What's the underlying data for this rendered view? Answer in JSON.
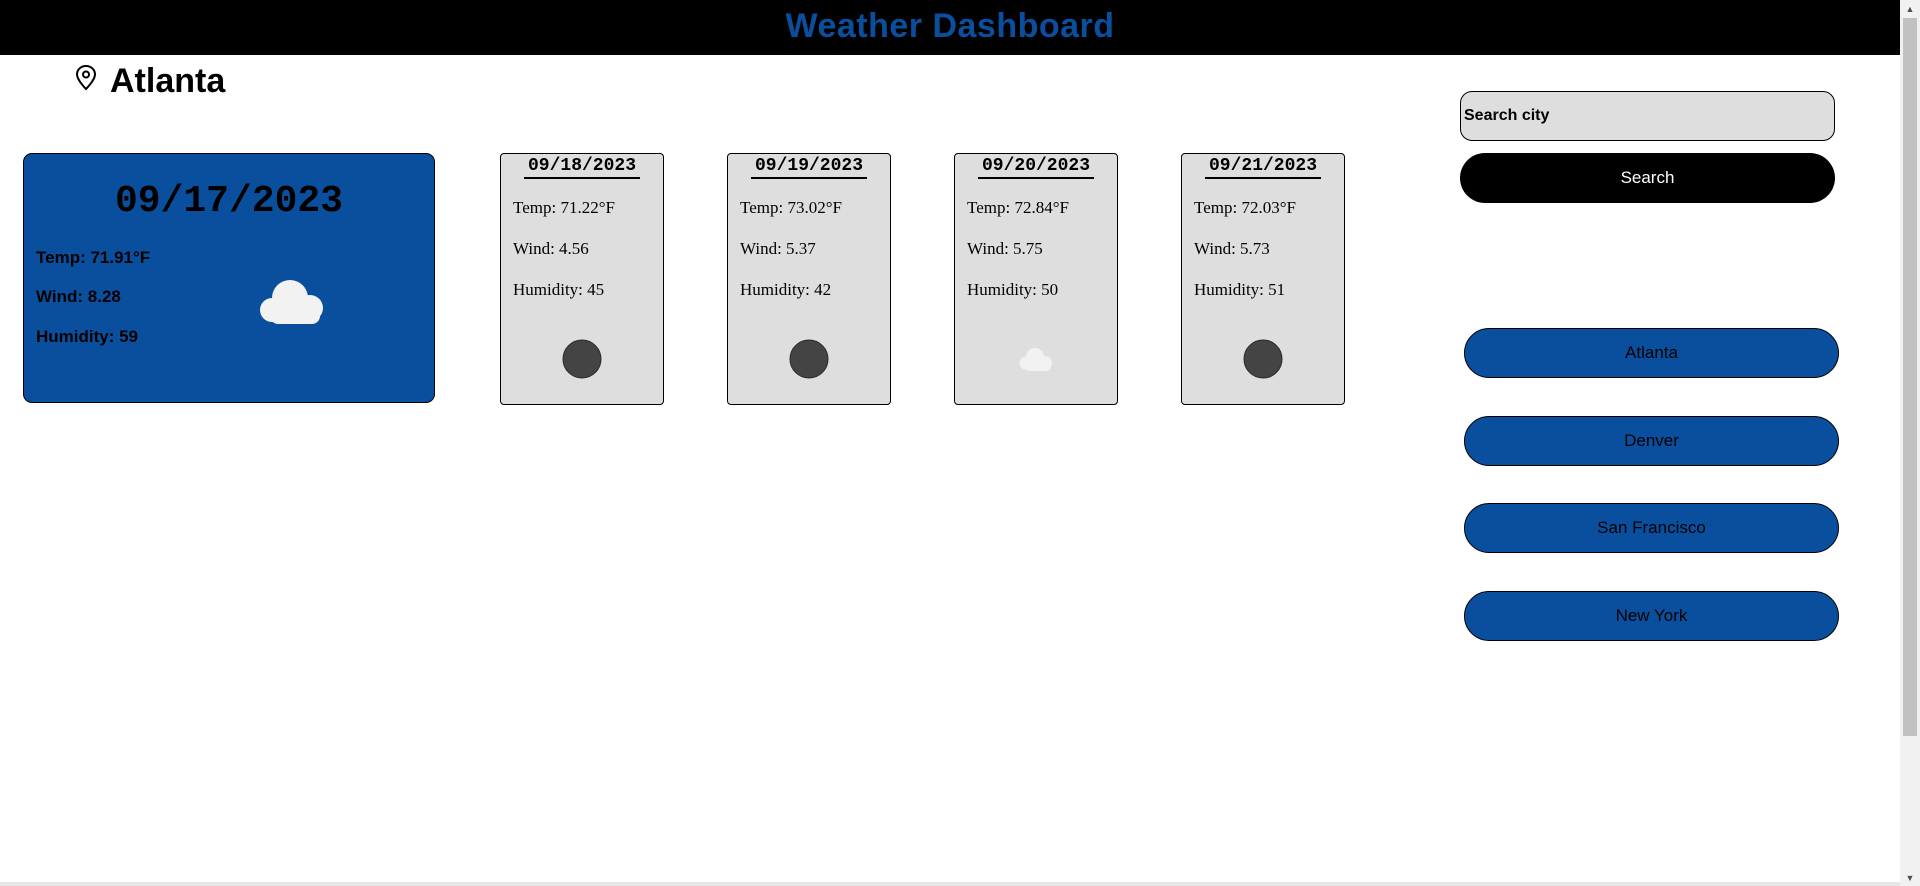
{
  "header": {
    "title": "Weather Dashboard"
  },
  "current": {
    "city": "Atlanta",
    "date": "09/17/2023",
    "temp": "Temp: 71.91°F",
    "wind": "Wind: 8.28",
    "humidity": "Humidity: 59",
    "icon": "cloud-icon"
  },
  "forecast": [
    {
      "date": "09/18/2023",
      "temp": "Temp: 71.22°F",
      "wind": "Wind: 4.56",
      "humidity": "Humidity: 45",
      "icon": "dark-circle-icon"
    },
    {
      "date": "09/19/2023",
      "temp": "Temp: 73.02°F",
      "wind": "Wind: 5.37",
      "humidity": "Humidity: 42",
      "icon": "dark-circle-icon"
    },
    {
      "date": "09/20/2023",
      "temp": "Temp: 72.84°F",
      "wind": "Wind: 5.75",
      "humidity": "Humidity: 50",
      "icon": "cloud-icon"
    },
    {
      "date": "09/21/2023",
      "temp": "Temp: 72.03°F",
      "wind": "Wind: 5.73",
      "humidity": "Humidity: 51",
      "icon": "dark-circle-icon"
    }
  ],
  "search": {
    "placeholder": "Search city",
    "button_label": "Search"
  },
  "history": [
    "Atlanta",
    "Denver",
    "San Francisco",
    "New York"
  ],
  "colors": {
    "accent": "#0a4f9e",
    "header_bg": "#000000",
    "card_bg": "#dedede"
  }
}
